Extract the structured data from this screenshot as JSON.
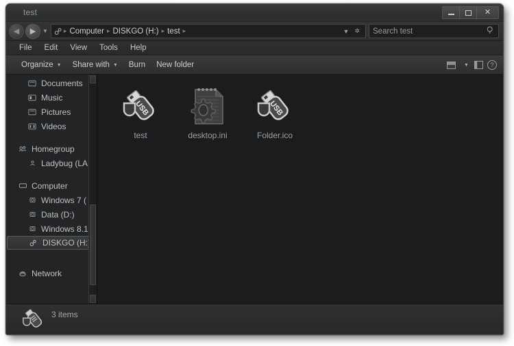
{
  "window": {
    "title": "test",
    "controls": {
      "minimize": "minimize",
      "maximize": "maximize",
      "close": "close"
    }
  },
  "address_bar": {
    "back": "back",
    "forward": "forward",
    "history_dropdown": "recent-locations",
    "root_icon": "usb-drive-icon",
    "breadcrumbs": [
      "Computer",
      "DISKGO (H:)",
      "test"
    ],
    "separator": "▸",
    "dropdown_icon": "chevron-down-icon",
    "refresh_icon": "refresh-icon"
  },
  "search": {
    "placeholder": "Search test",
    "icon": "search-icon"
  },
  "menu": {
    "items": [
      "File",
      "Edit",
      "View",
      "Tools",
      "Help"
    ]
  },
  "toolbar": {
    "items": [
      {
        "label": "Organize",
        "has_caret": true
      },
      {
        "label": "Share with",
        "has_caret": true
      },
      {
        "label": "Burn",
        "has_caret": false
      },
      {
        "label": "New folder",
        "has_caret": false
      }
    ],
    "view_icon": "change-view-icon",
    "view_caret": "chevron-down-icon",
    "preview_icon": "preview-pane-icon",
    "help_icon": "help-icon",
    "help_glyph": "?"
  },
  "nav_pane": {
    "items": [
      {
        "label": "Documents",
        "icon": "documents-folder-icon",
        "level": 2,
        "selected": false
      },
      {
        "label": "Music",
        "icon": "music-folder-icon",
        "level": 2,
        "selected": false
      },
      {
        "label": "Pictures",
        "icon": "pictures-folder-icon",
        "level": 2,
        "selected": false
      },
      {
        "label": "Videos",
        "icon": "videos-folder-icon",
        "level": 2,
        "selected": false
      },
      {
        "label": "Homegroup",
        "icon": "homegroup-icon",
        "level": 1,
        "selected": false
      },
      {
        "label": "Ladybug (LA",
        "icon": "homegroup-user-icon",
        "level": 2,
        "selected": false
      },
      {
        "label": "Computer",
        "icon": "computer-icon",
        "level": 1,
        "selected": false
      },
      {
        "label": "Windows 7 (",
        "icon": "hard-drive-icon",
        "level": 2,
        "selected": false
      },
      {
        "label": "Data (D:)",
        "icon": "hard-drive-icon",
        "level": 2,
        "selected": false
      },
      {
        "label": "Windows 8.1",
        "icon": "hard-drive-icon",
        "level": 2,
        "selected": false
      },
      {
        "label": "DISKGO (H:)",
        "icon": "usb-drive-icon",
        "level": 2,
        "selected": true
      },
      {
        "label": "Network",
        "icon": "network-icon",
        "level": 1,
        "selected": false
      }
    ],
    "scrollbar": {
      "up": "scroll-up-arrow",
      "down": "scroll-down-arrow"
    }
  },
  "files": [
    {
      "name": "test",
      "icon": "usb-drive-icon"
    },
    {
      "name": "desktop.ini",
      "icon": "ini-config-file-icon"
    },
    {
      "name": "Folder.ico",
      "icon": "usb-drive-icon"
    }
  ],
  "status_bar": {
    "item_count": "3 items",
    "icon": "usb-drive-icon"
  },
  "colors": {
    "window_bg": "#2b2b2b",
    "pane_bg": "#1c1c1c",
    "nav_bg": "#242424",
    "text": "#c9c9c9",
    "label_text": "#97a2ab",
    "title_text": "#8e9aa4",
    "selection_border": "#5b5b5b"
  }
}
